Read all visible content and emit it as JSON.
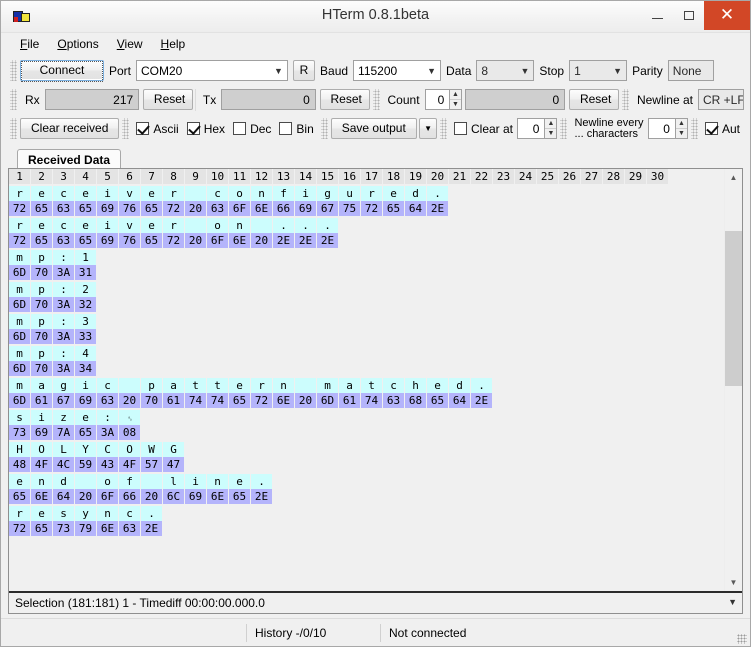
{
  "window": {
    "title": "HTerm 0.8.1beta",
    "icon": "app-icon",
    "minimize": "–",
    "maximize": "❐",
    "close": "✕"
  },
  "menu": [
    {
      "label": "File",
      "accel": "F"
    },
    {
      "label": "Options",
      "accel": "O"
    },
    {
      "label": "View",
      "accel": "V"
    },
    {
      "label": "Help",
      "accel": "H"
    }
  ],
  "toolbar_connection": {
    "connect_label": "Connect",
    "port_label": "Port",
    "port_value": "COM20",
    "rescan_label": "R",
    "baud_label": "Baud",
    "baud_value": "115200",
    "data_label": "Data",
    "data_value": "8",
    "stop_label": "Stop",
    "stop_value": "1",
    "parity_label": "Parity",
    "parity_value": "None"
  },
  "toolbar_counters": {
    "rx_label": "Rx",
    "rx_value": "217",
    "rx_reset": "Reset",
    "tx_label": "Tx",
    "tx_value": "0",
    "tx_reset": "Reset",
    "count_label": "Count",
    "count_value": "0",
    "count_total": "0",
    "count_reset": "Reset",
    "newline_at_label": "Newline at",
    "newline_at_value": "CR +LF"
  },
  "toolbar_options": {
    "clear_received": "Clear received",
    "ascii_label": "Ascii",
    "ascii_checked": true,
    "hex_label": "Hex",
    "hex_checked": true,
    "dec_label": "Dec",
    "dec_checked": false,
    "bin_label": "Bin",
    "bin_checked": false,
    "save_output": "Save output",
    "save_output_arrow": "▼",
    "clear_at_label": "Clear at",
    "clear_at_checked": false,
    "clear_at_value": "0",
    "newline_every_line1": "Newline every",
    "newline_every_line2": "... characters",
    "newline_every_value": "0",
    "auto_label": "Aut",
    "auto_checked": true
  },
  "tab": {
    "label": "Received Data"
  },
  "grid": {
    "columns": [
      "1",
      "2",
      "3",
      "4",
      "5",
      "6",
      "7",
      "8",
      "9",
      "10",
      "11",
      "12",
      "13",
      "14",
      "15",
      "16",
      "17",
      "18",
      "19",
      "20",
      "21",
      "22",
      "23",
      "24",
      "25",
      "26",
      "27",
      "28",
      "29",
      "30"
    ],
    "ascii_bg": "#ccfdfd",
    "hex_bg": "#b4b4fb",
    "blocks": [
      {
        "ascii": [
          "r",
          "e",
          "c",
          "e",
          "i",
          "v",
          "e",
          "r",
          " ",
          "c",
          "o",
          "n",
          "f",
          "i",
          "g",
          "u",
          "r",
          "e",
          "d",
          "."
        ],
        "hex": [
          "72",
          "65",
          "63",
          "65",
          "69",
          "76",
          "65",
          "72",
          "20",
          "63",
          "6F",
          "6E",
          "66",
          "69",
          "67",
          "75",
          "72",
          "65",
          "64",
          "2E"
        ]
      },
      {
        "ascii": [
          "r",
          "e",
          "c",
          "e",
          "i",
          "v",
          "e",
          "r",
          " ",
          "o",
          "n",
          " ",
          ".",
          ".",
          "."
        ],
        "hex": [
          "72",
          "65",
          "63",
          "65",
          "69",
          "76",
          "65",
          "72",
          "20",
          "6F",
          "6E",
          "20",
          "2E",
          "2E",
          "2E"
        ]
      },
      {
        "ascii": [
          "m",
          "p",
          ":",
          "1"
        ],
        "hex": [
          "6D",
          "70",
          "3A",
          "31"
        ]
      },
      {
        "ascii": [
          "m",
          "p",
          ":",
          "2"
        ],
        "hex": [
          "6D",
          "70",
          "3A",
          "32"
        ]
      },
      {
        "ascii": [
          "m",
          "p",
          ":",
          "3"
        ],
        "hex": [
          "6D",
          "70",
          "3A",
          "33"
        ]
      },
      {
        "ascii": [
          "m",
          "p",
          ":",
          "4"
        ],
        "hex": [
          "6D",
          "70",
          "3A",
          "34"
        ]
      },
      {
        "ascii": [
          "m",
          "a",
          "g",
          "i",
          "c",
          " ",
          "p",
          "a",
          "t",
          "t",
          "e",
          "r",
          "n",
          " ",
          "m",
          "a",
          "t",
          "c",
          "h",
          "e",
          "d",
          "."
        ],
        "hex": [
          "6D",
          "61",
          "67",
          "69",
          "63",
          "20",
          "70",
          "61",
          "74",
          "74",
          "65",
          "72",
          "6E",
          "20",
          "6D",
          "61",
          "74",
          "63",
          "68",
          "65",
          "64",
          "2E"
        ]
      },
      {
        "ascii": [
          "s",
          "i",
          "z",
          "e",
          ":",
          "␈"
        ],
        "hex": [
          "73",
          "69",
          "7A",
          "65",
          "3A",
          "08"
        ]
      },
      {
        "ascii": [
          "H",
          "O",
          "L",
          "Y",
          "C",
          "O",
          "W",
          "G"
        ],
        "hex": [
          "48",
          "4F",
          "4C",
          "59",
          "43",
          "4F",
          "57",
          "47"
        ]
      },
      {
        "ascii": [
          "e",
          "n",
          "d",
          " ",
          "o",
          "f",
          " ",
          "l",
          "i",
          "n",
          "e",
          "."
        ],
        "hex": [
          "65",
          "6E",
          "64",
          "20",
          "6F",
          "66",
          "20",
          "6C",
          "69",
          "6E",
          "65",
          "2E"
        ]
      },
      {
        "ascii": [
          "r",
          "e",
          "s",
          "y",
          "n",
          "c",
          "."
        ],
        "hex": [
          "72",
          "65",
          "73",
          "79",
          "6E",
          "63",
          "2E"
        ]
      }
    ]
  },
  "selection_status": "Selection (181:181) 1  -  Timediff 00:00:00.000.0",
  "statusbar": {
    "history": "History -/0/10",
    "connection": "Not connected"
  }
}
